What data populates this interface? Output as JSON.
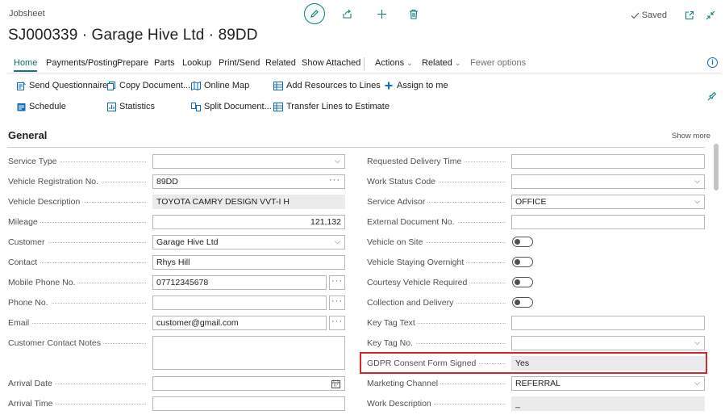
{
  "header": {
    "page_kind": "Jobsheet",
    "title": "SJ000339 · Garage Hive Ltd · 89DD",
    "saved_label": "Saved"
  },
  "tabs": {
    "home": "Home",
    "payments": "Payments/Posting",
    "prepare": "Prepare",
    "parts": "Parts",
    "lookup": "Lookup",
    "print_send": "Print/Send",
    "related": "Related",
    "show_attached": "Show Attached",
    "actions": "Actions",
    "related2": "Related",
    "fewer": "Fewer options"
  },
  "commands": {
    "send_questionnaire": "Send Questionnaire",
    "copy_document": "Copy Document...",
    "online_map": "Online Map",
    "add_resources": "Add Resources to Lines",
    "assign_to_me": "Assign to me",
    "schedule": "Schedule",
    "statistics": "Statistics",
    "split_document": "Split Document...",
    "transfer_lines": "Transfer Lines to Estimate"
  },
  "section": {
    "title": "General",
    "show_more": "Show more"
  },
  "left": {
    "service_type": {
      "label": "Service Type",
      "value": ""
    },
    "vehicle_reg": {
      "label": "Vehicle Registration No.",
      "value": "89DD"
    },
    "vehicle_desc": {
      "label": "Vehicle Description",
      "value": "TOYOTA CAMRY DESIGN VVT-I H"
    },
    "mileage": {
      "label": "Mileage",
      "value": "121,132"
    },
    "customer": {
      "label": "Customer",
      "value": "Garage Hive Ltd"
    },
    "contact": {
      "label": "Contact",
      "value": "Rhys Hill"
    },
    "mobile": {
      "label": "Mobile Phone No.",
      "value": "07712345678"
    },
    "phone": {
      "label": "Phone No.",
      "value": ""
    },
    "email": {
      "label": "Email",
      "value": "customer@gmail.com"
    },
    "contact_notes": {
      "label": "Customer Contact Notes",
      "value": ""
    },
    "arrival_date": {
      "label": "Arrival Date",
      "value": ""
    },
    "arrival_time": {
      "label": "Arrival Time",
      "value": ""
    }
  },
  "right": {
    "requested_delivery": {
      "label": "Requested Delivery Time",
      "value": ""
    },
    "work_status": {
      "label": "Work Status Code",
      "value": ""
    },
    "service_advisor": {
      "label": "Service Advisor",
      "value": "OFFICE"
    },
    "external_doc": {
      "label": "External Document No.",
      "value": ""
    },
    "vehicle_on_site": {
      "label": "Vehicle on Site",
      "value": false
    },
    "staying_overnight": {
      "label": "Vehicle Staying Overnight",
      "value": false
    },
    "courtesy_vehicle": {
      "label": "Courtesy Vehicle Required",
      "value": false
    },
    "collection_delivery": {
      "label": "Collection and Delivery",
      "value": false
    },
    "key_tag_text": {
      "label": "Key Tag Text",
      "value": ""
    },
    "key_tag_no": {
      "label": "Key Tag No.",
      "value": ""
    },
    "gdpr": {
      "label": "GDPR Consent Form Signed",
      "value": "Yes"
    },
    "marketing_channel": {
      "label": "Marketing Channel",
      "value": "REFERRAL"
    },
    "work_description": {
      "label": "Work Description",
      "value": "_"
    }
  },
  "colors": {
    "accent": "#0f7b7b",
    "highlight": "#d9232d"
  }
}
